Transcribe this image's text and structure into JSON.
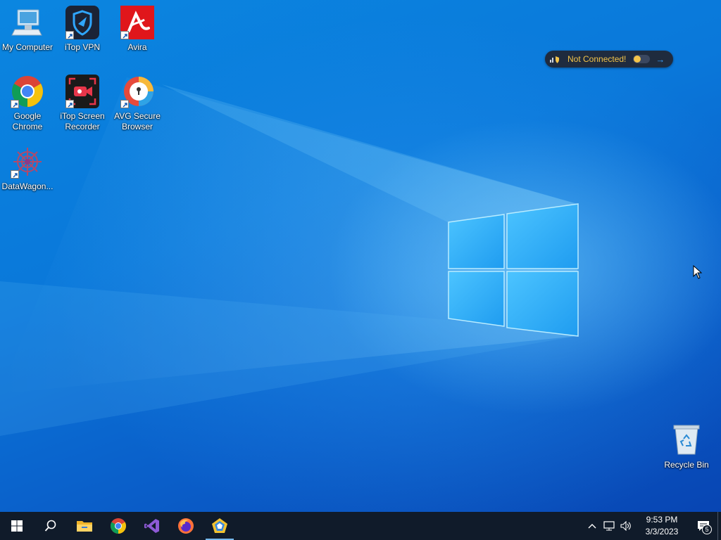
{
  "desktop": {
    "icons": [
      {
        "label": "My Computer",
        "icon": "computer-icon"
      },
      {
        "label": "iTop VPN",
        "icon": "itop-vpn-icon"
      },
      {
        "label": "Avira",
        "icon": "avira-icon"
      },
      {
        "label": "Google Chrome",
        "icon": "chrome-icon"
      },
      {
        "label": "iTop Screen Recorder",
        "icon": "itop-screen-recorder-icon"
      },
      {
        "label": "AVG Secure Browser",
        "icon": "avg-secure-browser-icon"
      },
      {
        "label": "DataWagon...",
        "icon": "datawagon-icon"
      },
      {
        "label": "Recycle Bin",
        "icon": "recycle-bin-icon"
      }
    ]
  },
  "vpn_widget": {
    "status": "Not Connected!",
    "toggle_on": false,
    "accent": "#f3c44a"
  },
  "taskbar": {
    "apps": [
      "start-icon",
      "search-icon",
      "file-explorer-icon",
      "chrome-icon",
      "visual-studio-icon",
      "firefox-icon",
      "datawagon-app-icon"
    ],
    "active_app": "datawagon-app-icon",
    "time": "9:53 PM",
    "date": "3/3/2023",
    "notification_count": "5"
  },
  "colors": {
    "taskbar": "#101b2a",
    "wallpaper": "#0a78da"
  }
}
